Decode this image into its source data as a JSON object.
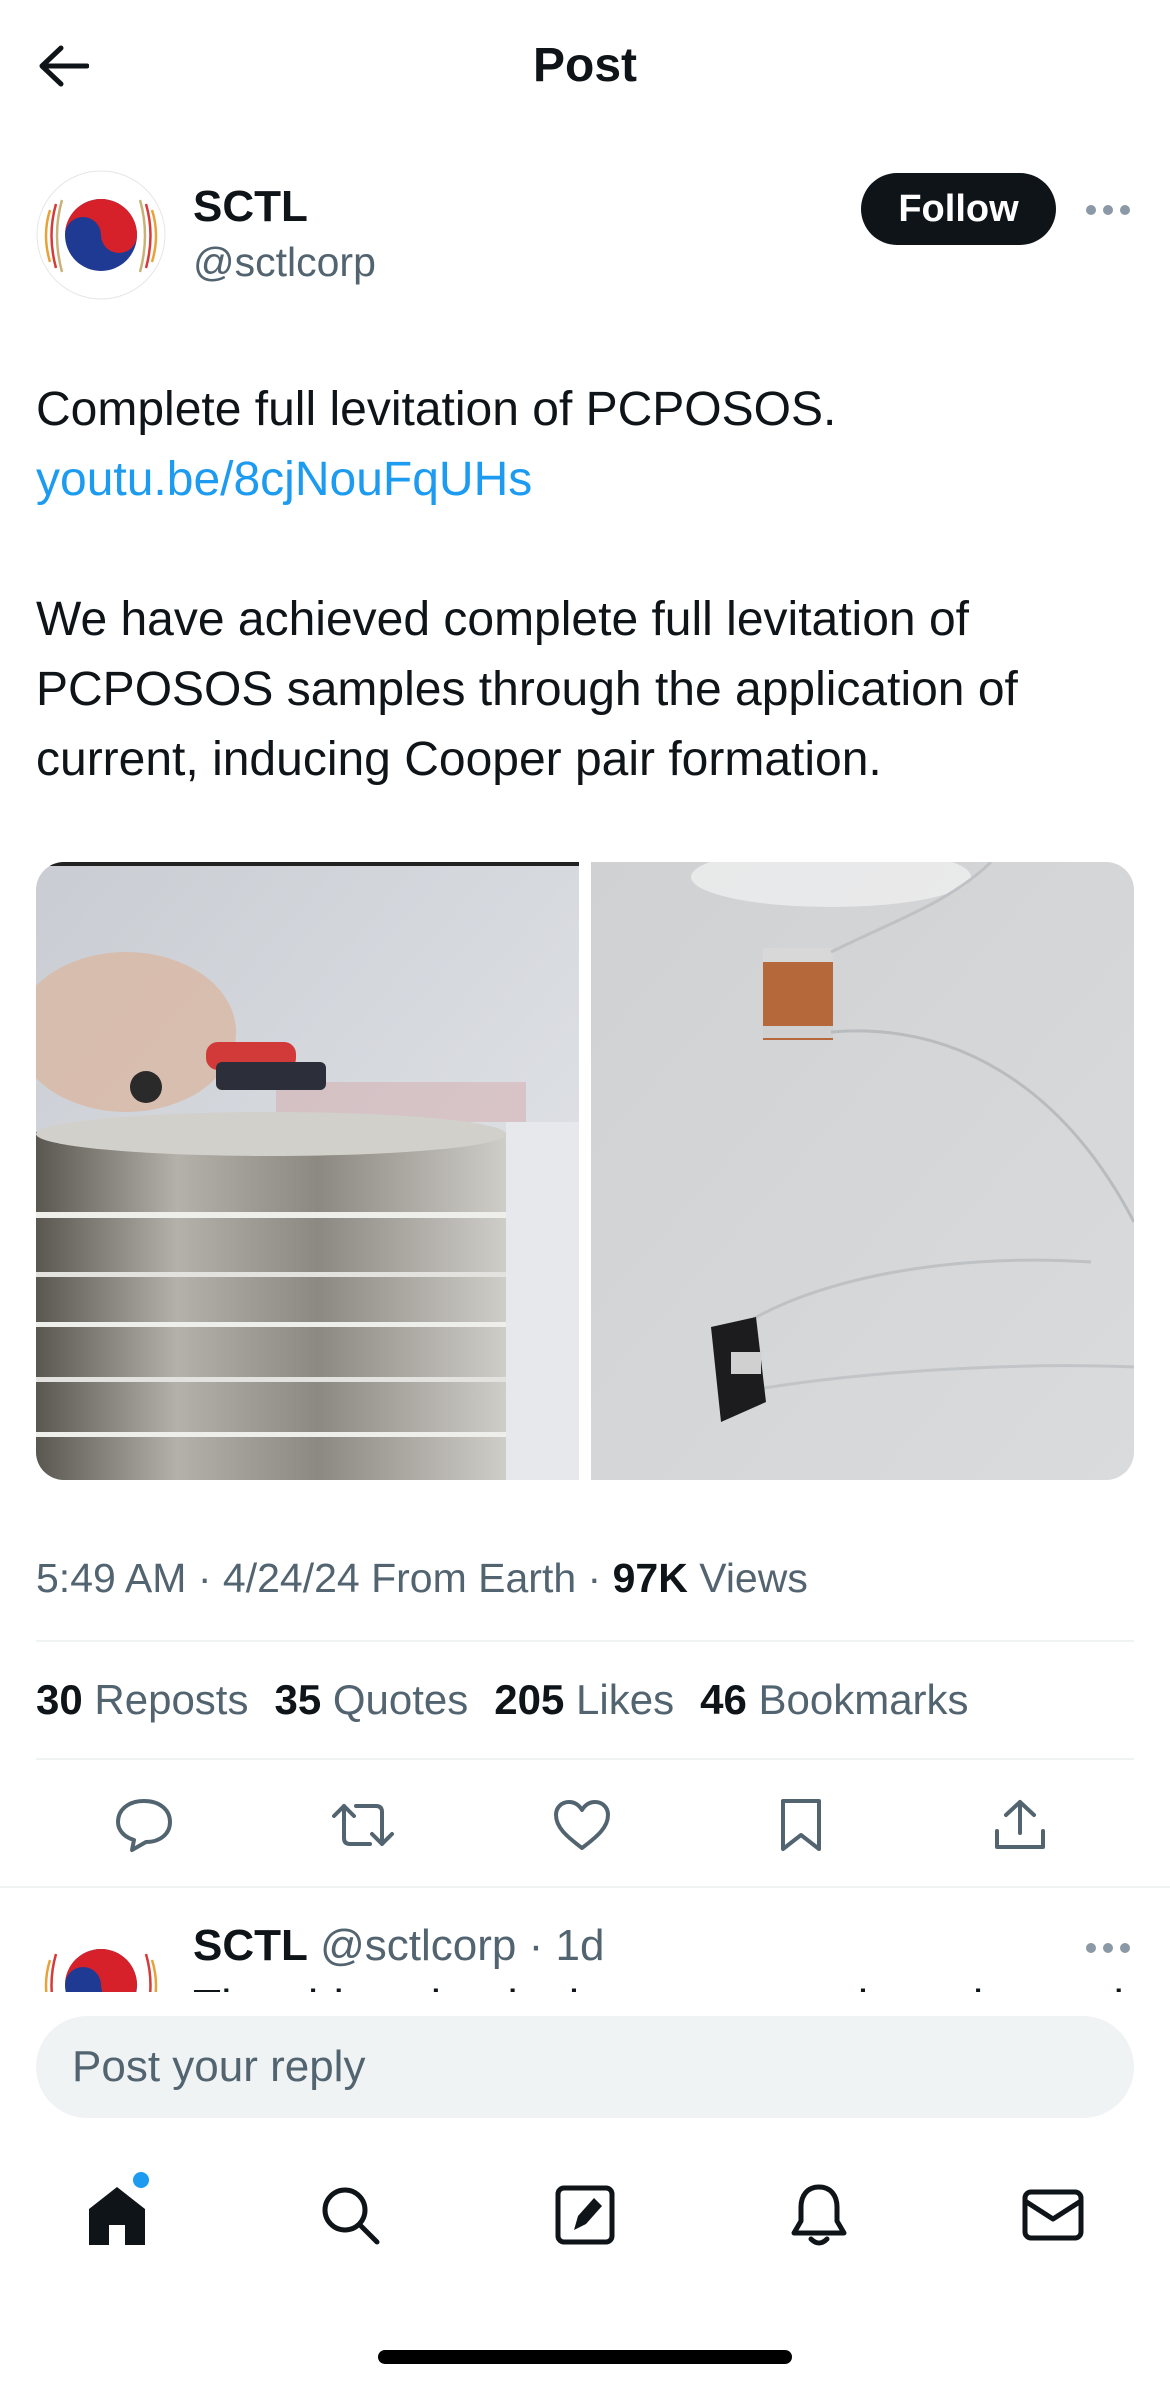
{
  "header": {
    "title": "Post",
    "back_icon": "arrow-left-icon"
  },
  "post": {
    "author_name": "SCTL",
    "author_handle": "@sctlcorp",
    "follow_label": "Follow",
    "text_line1": "Complete full levitation of PCPOSOS.",
    "link": "youtu.be/8cjNouFqUHs",
    "paragraph": "We have achieved complete full levitation of PCPOSOS samples through the application of current, inducing Cooper pair formation.",
    "time": "5:49 AM",
    "date": "4/24/24",
    "source": "From Earth",
    "views_count": "97K",
    "views_label": "Views",
    "stats": {
      "reposts_count": "30",
      "reposts_label": "Reposts",
      "quotes_count": "35",
      "quotes_label": "Quotes",
      "likes_count": "205",
      "likes_label": "Likes",
      "bookmarks_count": "46",
      "bookmarks_label": "Bookmarks"
    }
  },
  "reply_preview": {
    "name": "SCTL",
    "handle": "@sctlcorp",
    "age": "1d",
    "text": "The video clearly demonstrates the enhanced"
  },
  "composer": {
    "placeholder": "Post your reply"
  },
  "nav": {
    "items": [
      "home-icon",
      "search-icon",
      "compose-icon",
      "notifications-icon",
      "messages-icon"
    ]
  },
  "colors": {
    "accent": "#1d9bf0",
    "text": "#0f1419",
    "secondary": "#536471"
  }
}
